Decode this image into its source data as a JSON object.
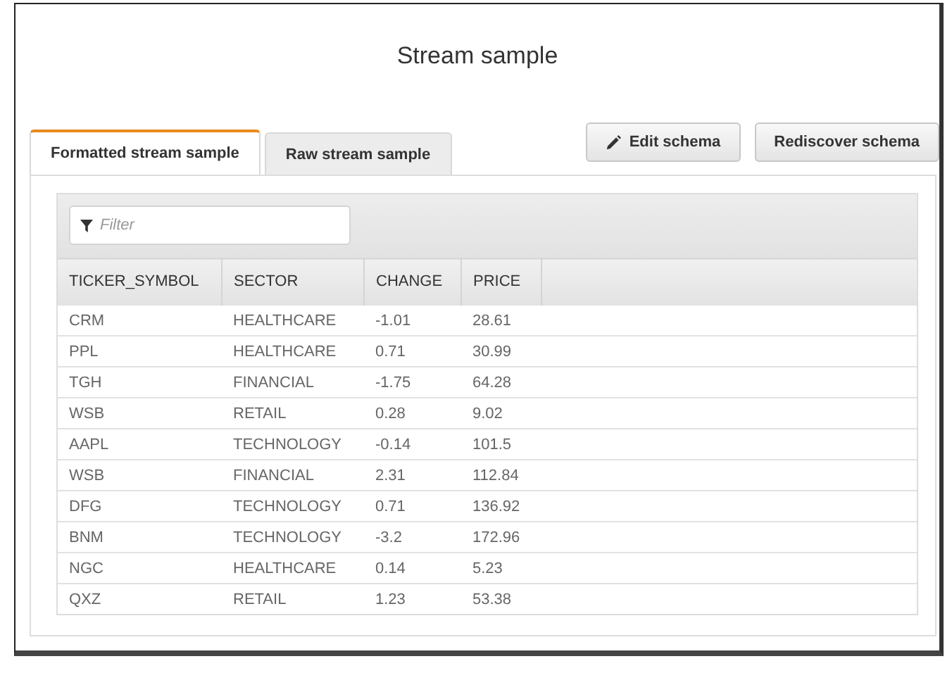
{
  "title": "Stream sample",
  "tabs": [
    {
      "label": "Formatted stream sample",
      "selected": true
    },
    {
      "label": "Raw stream sample",
      "selected": false
    }
  ],
  "buttons": [
    {
      "label": "Edit schema",
      "kind": "edit"
    },
    {
      "label": "Rediscover schema",
      "kind": "plain"
    }
  ],
  "filter": {
    "placeholder": "Filter"
  },
  "table": {
    "columns": [
      "TICKER_SYMBOL",
      "SECTOR",
      "CHANGE",
      "PRICE"
    ],
    "rows": [
      [
        "CRM",
        "HEALTHCARE",
        "-1.01",
        "28.61"
      ],
      [
        "PPL",
        "HEALTHCARE",
        "0.71",
        "30.99"
      ],
      [
        "TGH",
        "FINANCIAL",
        "-1.75",
        "64.28"
      ],
      [
        "WSB",
        "RETAIL",
        "0.28",
        "9.02"
      ],
      [
        "AAPL",
        "TECHNOLOGY",
        "-0.14",
        "101.5"
      ],
      [
        "WSB",
        "FINANCIAL",
        "2.31",
        "112.84"
      ],
      [
        "DFG",
        "TECHNOLOGY",
        "0.71",
        "136.92"
      ],
      [
        "BNM",
        "TECHNOLOGY",
        "-3.2",
        "172.96"
      ],
      [
        "NGC",
        "HEALTHCARE",
        "0.14",
        "5.23"
      ],
      [
        "QXZ",
        "RETAIL",
        "1.23",
        "53.38"
      ]
    ]
  }
}
